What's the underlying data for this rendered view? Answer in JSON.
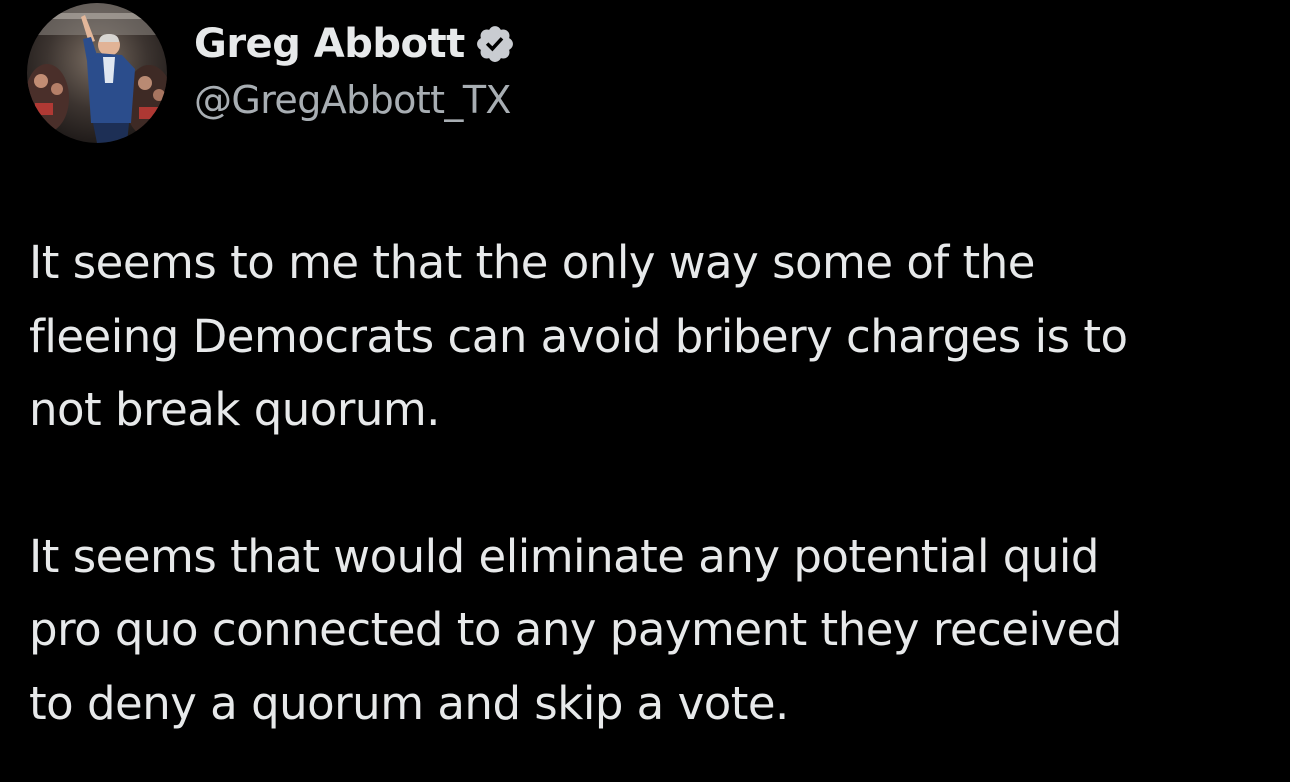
{
  "tweet": {
    "author": {
      "display_name": "Greg Abbott",
      "handle": "@GregAbbott_TX",
      "verified_icon": "verified-badge-icon",
      "avatar_icon": "profile-photo"
    },
    "paragraphs": [
      {
        "lines": [
          "It seems to me that the only way some of the",
          "fleeing Democrats can avoid bribery charges is to",
          "not break quorum."
        ]
      },
      {
        "lines": [
          "It seems that would eliminate any potential quid",
          "pro quo connected to any payment they received",
          "to deny a quorum and skip a vote."
        ]
      }
    ]
  },
  "colors": {
    "background": "#000000",
    "text_primary": "#e7e9ea",
    "text_secondary": "#a8aeb3",
    "verified_fill": "#c9ccd1"
  }
}
